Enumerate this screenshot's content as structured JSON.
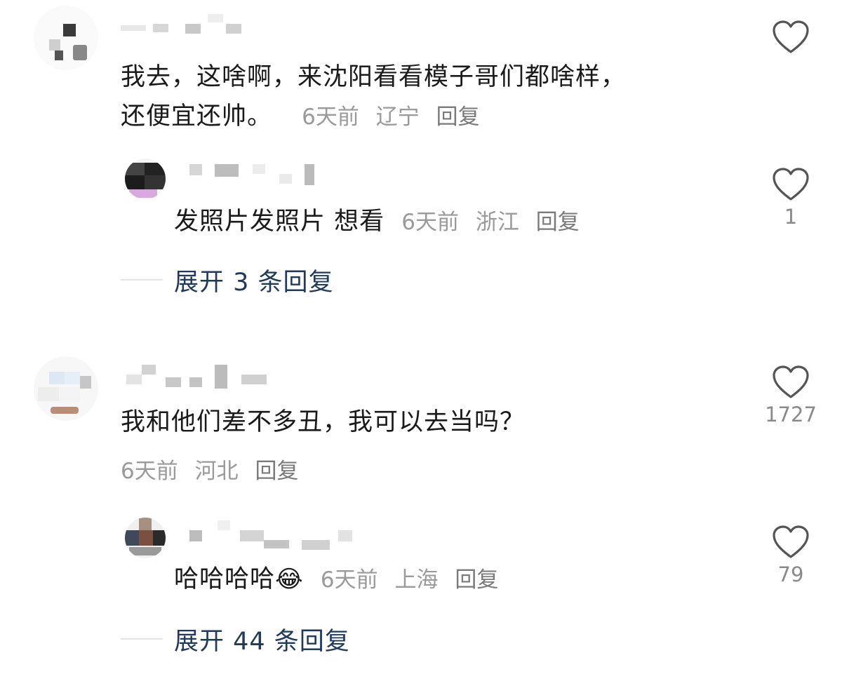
{
  "comments": [
    {
      "text_line1": "我去，这啥啊，来沈阳看看模子哥们都啥样，",
      "text_line2": "还便宜还帅。",
      "time": "6天前",
      "location": "辽宁",
      "reply_label": "回复",
      "likes": "",
      "reply": {
        "text": "发照片发照片 想看",
        "time": "6天前",
        "location": "浙江",
        "reply_label": "回复",
        "likes": "1"
      },
      "expand_label": "展开 3 条回复"
    },
    {
      "text_line1": "我和他们差不多丑，我可以去当吗？",
      "time": "6天前",
      "location": "河北",
      "reply_label": "回复",
      "likes": "1727",
      "reply": {
        "text": "哈哈哈哈",
        "emoji": "😂",
        "time": "6天前",
        "location": "上海",
        "reply_label": "回复",
        "likes": "79"
      },
      "expand_label": "展开 44 条回复"
    }
  ],
  "icons": {
    "like": "heart-outline-icon"
  },
  "colors": {
    "text": "#1a1a1a",
    "meta": "#9a9a9a",
    "expand": "#1f3a5c",
    "heart": "#555555"
  }
}
